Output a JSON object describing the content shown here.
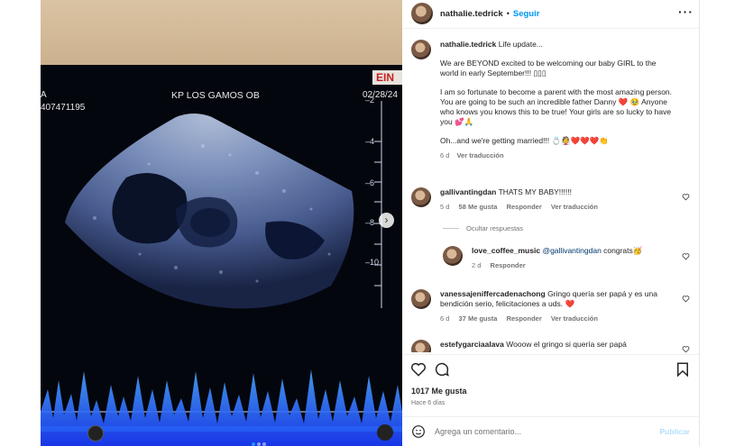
{
  "media": {
    "clinic": "KP LOS GAMOS OB",
    "date": "02/28/24",
    "ein": "EIN",
    "id_fragment": "407471195",
    "side_a": "A",
    "scale": [
      "2",
      "4",
      "6",
      "8",
      "10"
    ],
    "next_icon": "chevron-right-icon"
  },
  "post": {
    "author": "nathalie.tedrick",
    "separator": "•",
    "follow": "Seguir",
    "more_icon": "more-horizontal-icon"
  },
  "caption": {
    "author": "nathalie.tedrick",
    "p1": "Life update...",
    "p2": "We are BEYOND excited to be welcoming our baby GIRL to the world in early September!!! ▯▯▯",
    "p3": "I am so fortunate to become a parent with the most amazing person. You are going to be such an incredible father Danny ❤️ 🥹 Anyone who knows you knows this to be true! Your girls are so lucky to have you 💕🙏",
    "p4": "Oh...and we're getting married!!! 💍👰❤️❤️❤️👏",
    "time": "6 d",
    "translate": "Ver traducción"
  },
  "comments": [
    {
      "user": "gallivantingdan",
      "text": "THATS MY BABY!!!!!!",
      "time": "5 d",
      "likes": "58 Me gusta",
      "reply": "Responder",
      "translate": "Ver traducción"
    },
    {
      "user": "vanessajeniffercadenachong",
      "text": "Gringo quería ser papá y es una bendición serio, felicitaciones a uds. ❤️",
      "time": "6 d",
      "likes": "37 Me gusta",
      "reply": "Responder",
      "translate": "Ver traducción"
    },
    {
      "user": "estefygarciaalava",
      "text": "Wooow el gringo si quería ser papá"
    }
  ],
  "hide_replies": "Ocultar respuestas",
  "reply": {
    "user": "love_coffee_music",
    "mention": "@gallivantingdan",
    "text": "congrats🥳",
    "time": "2 d",
    "reply": "Responder"
  },
  "actions": {
    "like_icon": "heart-icon",
    "comment_icon": "comment-icon",
    "save_icon": "bookmark-icon"
  },
  "likes": "1017 Me gusta",
  "posted": "Hace 6 días",
  "add_comment": {
    "placeholder": "Agrega un comentario...",
    "post": "Publicar",
    "emoji_icon": "smiley-icon"
  },
  "colors": {
    "accent": "#0095f6",
    "heart_red": "#ed4956",
    "post_disabled": "#b2dffc"
  }
}
